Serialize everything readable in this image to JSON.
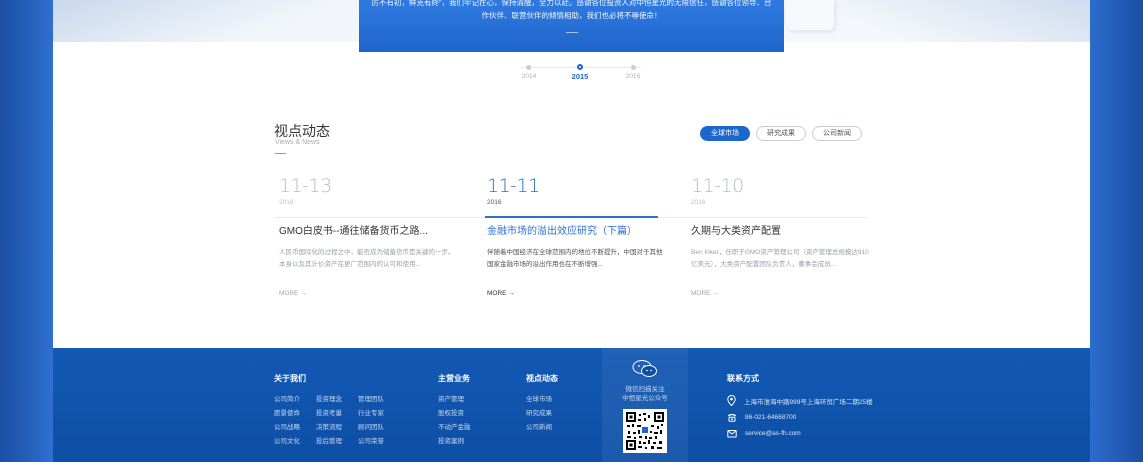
{
  "hero": {
    "line1": "厉不有初，鲜克有终”，我们牢记在心，保持清醒，全力以赴。感谢各位投资人对中恒星光的无限信任，感谢各位领导、合",
    "line2": "作伙伴、联营伙伴的倾情相助，我们也必将不辱使命！"
  },
  "timeline": {
    "years": [
      "2014",
      "2015",
      "2016"
    ],
    "active": "2015"
  },
  "news": {
    "title": "视点动态",
    "subtitle": "Views & News",
    "tabs": [
      "全球市场",
      "研究成果",
      "公司新闻"
    ],
    "active_tab": "全球市场",
    "items": [
      {
        "date": "11-13",
        "year": "2016",
        "title": "GMO白皮书--通往储备货币之路...",
        "desc": "人民币国际化的过程之中，能否成为储备货币是关键的一步。本身以及其计价资产在更广范围内的认可和使用...",
        "more": "MORE →"
      },
      {
        "date": "11-11",
        "year": "2016",
        "title": "金融市场的溢出效应研究（下篇）",
        "desc": "伴随着中国经济在全球范围内的地位不断提升，中国对于其他国家金融市场的溢出作用也在不断增强...",
        "more": "MORE →"
      },
      {
        "date": "11-10",
        "year": "2016",
        "title": "久期与大类资产配置",
        "desc": "Ben Inker，任职于GMO资产管理公司（资产管理总规模达910亿美元），大类资产配置团队负责人，董事会成员...",
        "more": "MORE →"
      }
    ]
  },
  "footer": {
    "about": {
      "heading": "关于我们",
      "links": [
        "公司简介",
        "投资理念",
        "管理团队",
        "愿景使命",
        "投资考量",
        "行业专家",
        "公司战略",
        "决策流程",
        "顾问团队",
        "公司文化",
        "投后管理",
        "公司荣誉"
      ]
    },
    "business": {
      "heading": "主营业务",
      "links": [
        "资产管理",
        "股权投资",
        "不动产金融",
        "投资案例"
      ]
    },
    "views": {
      "heading": "视点动态",
      "links": [
        "全球市场",
        "研究成果",
        "公司新闻"
      ]
    },
    "wechat": {
      "line1": "微信扫描关注",
      "line2": "中恒星光公众号"
    },
    "contact": {
      "heading": "联系方式",
      "address": "上海市淮海中路999号上海环贸广场二期25楼",
      "phone": "86-021-64668700",
      "email": "service@as-fh.com"
    }
  },
  "colors": {
    "brand_blue": "#1e66cf",
    "footer_blue": "#0e4fa6"
  }
}
